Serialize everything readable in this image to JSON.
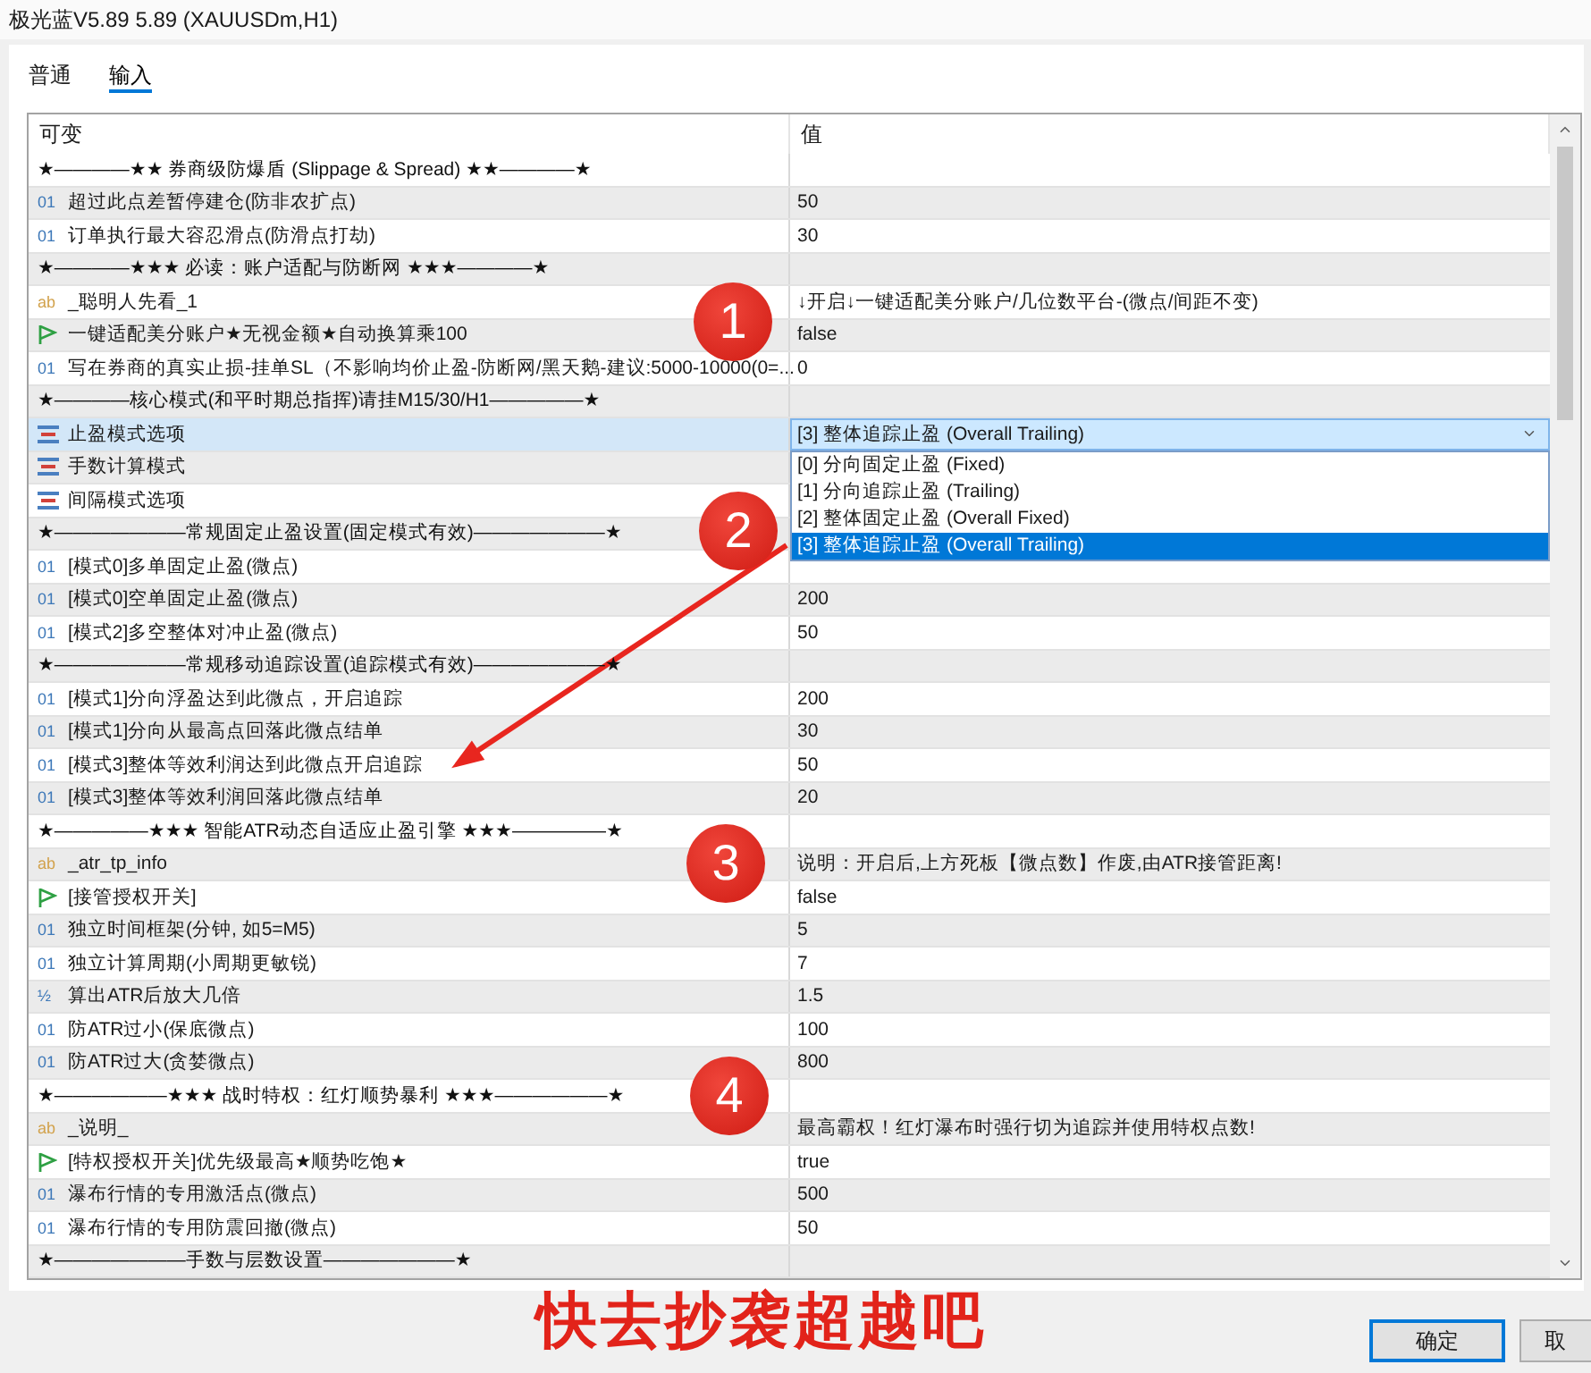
{
  "window": {
    "title": "极光蓝V5.89 5.89 (XAUUSDm,H1)"
  },
  "tabs": [
    {
      "label": "普通",
      "selected": false
    },
    {
      "label": "输入",
      "selected": true
    }
  ],
  "table": {
    "columns": [
      "可变",
      "值"
    ],
    "rows": [
      {
        "kind": "section",
        "name": "★————★★ 券商级防爆盾 (Slippage & Spread) ★★————★",
        "selected": false
      },
      {
        "kind": "int",
        "badge": "01",
        "name": "超过此点差暂停建仓(防非农扩点)",
        "value": "50",
        "selected": false
      },
      {
        "kind": "int",
        "badge": "01",
        "name": "订单执行最大容忍滑点(防滑点打劫)",
        "value": "30",
        "selected": false
      },
      {
        "kind": "section",
        "name": "★————★★★ 必读：账户适配与防断网 ★★★————★",
        "selected": false
      },
      {
        "kind": "string",
        "badge": "ab",
        "name": "_聪明人先看_1",
        "value": "↓开启↓一键适配美分账户/几位数平台-(微点/间距不变)",
        "selected": false
      },
      {
        "kind": "bool",
        "name": "一键适配美分账户★无视金额★自动换算乘100",
        "value": "false",
        "selected": false
      },
      {
        "kind": "int",
        "badge": "01",
        "name": "写在券商的真实止损-挂单SL（不影响均价止盈-防断网/黑天鹅-建议:5000-10000(0=...",
        "value": "0",
        "selected": false
      },
      {
        "kind": "section",
        "name": "★————核心模式(和平时期总指挥)请挂M15/30/H1—————★",
        "selected": false
      },
      {
        "kind": "enum",
        "name": "止盈模式选项",
        "selected": true,
        "dropdown": {
          "value": "[3] 整体追踪止盈 (Overall Trailing)",
          "expanded": true,
          "options": [
            {
              "label": "[0] 分向固定止盈 (Fixed)",
              "selected": false
            },
            {
              "label": "[1] 分向追踪止盈 (Trailing)",
              "selected": false
            },
            {
              "label": "[2] 整体固定止盈 (Overall Fixed)",
              "selected": false
            },
            {
              "label": "[3] 整体追踪止盈 (Overall Trailing)",
              "selected": true
            }
          ]
        }
      },
      {
        "kind": "enum",
        "name": "手数计算模式",
        "selected": false
      },
      {
        "kind": "enum",
        "name": "间隔模式选项",
        "selected": false
      },
      {
        "kind": "section",
        "name": "★———————常规固定止盈设置(固定模式有效)———————★",
        "selected": false
      },
      {
        "kind": "int",
        "badge": "01",
        "name": "[模式0]多单固定止盈(微点)",
        "selected": false
      },
      {
        "kind": "int",
        "badge": "01",
        "name": "[模式0]空单固定止盈(微点)",
        "value": "200",
        "selected": false
      },
      {
        "kind": "int",
        "badge": "01",
        "name": "[模式2]多空整体对冲止盈(微点)",
        "value": "50",
        "selected": false
      },
      {
        "kind": "section",
        "name": "★———————常规移动追踪设置(追踪模式有效)———————★",
        "selected": false
      },
      {
        "kind": "int",
        "badge": "01",
        "name": "[模式1]分向浮盈达到此微点，开启追踪",
        "value": "200",
        "selected": false
      },
      {
        "kind": "int",
        "badge": "01",
        "name": "[模式1]分向从最高点回落此微点结单",
        "value": "30",
        "selected": false
      },
      {
        "kind": "int",
        "badge": "01",
        "name": "[模式3]整体等效利润达到此微点开启追踪",
        "value": "50",
        "selected": false
      },
      {
        "kind": "int",
        "badge": "01",
        "name": "[模式3]整体等效利润回落此微点结单",
        "value": "20",
        "selected": false
      },
      {
        "kind": "section",
        "name": "★—————★★★ 智能ATR动态自适应止盈引擎 ★★★—————★",
        "selected": false
      },
      {
        "kind": "string",
        "badge": "ab",
        "name": "_atr_tp_info",
        "value": "说明：开启后,上方死板【微点数】作废,由ATR接管距离!",
        "selected": false
      },
      {
        "kind": "bool",
        "name": "[接管授权开关]",
        "value": "false",
        "selected": false
      },
      {
        "kind": "int",
        "badge": "01",
        "name": "独立时间框架(分钟, 如5=M5)",
        "value": "5",
        "selected": false
      },
      {
        "kind": "int",
        "badge": "01",
        "name": "独立计算周期(小周期更敏锐)",
        "value": "7",
        "selected": false
      },
      {
        "kind": "double",
        "badge": "½",
        "name": "算出ATR后放大几倍",
        "value": "1.5",
        "selected": false
      },
      {
        "kind": "int",
        "badge": "01",
        "name": "防ATR过小(保底微点)",
        "value": "100",
        "selected": false
      },
      {
        "kind": "int",
        "badge": "01",
        "name": "防ATR过大(贪婪微点)",
        "value": "800",
        "selected": false
      },
      {
        "kind": "section",
        "name": "★——————★★★ 战时特权：红灯顺势暴利 ★★★——————★",
        "selected": false
      },
      {
        "kind": "string",
        "badge": "ab",
        "name": "_说明_",
        "value": "最高霸权！红灯瀑布时强行切为追踪并使用特权点数!",
        "selected": false
      },
      {
        "kind": "bool",
        "name": "[特权授权开关]优先级最高★顺势吃饱★",
        "value": "true",
        "selected": false
      },
      {
        "kind": "int",
        "badge": "01",
        "name": "瀑布行情的专用激活点(微点)",
        "value": "500",
        "selected": false
      },
      {
        "kind": "int",
        "badge": "01",
        "name": "瀑布行情的专用防震回撤(微点)",
        "value": "50",
        "selected": false
      },
      {
        "kind": "section",
        "name": "★———————手数与层数设置———————★",
        "selected": false
      }
    ]
  },
  "buttons": [
    {
      "label": "确定",
      "default": true
    },
    {
      "label": "取",
      "default": false
    }
  ],
  "annotations": {
    "markers": [
      {
        "label": "1"
      },
      {
        "label": "2"
      },
      {
        "label": "3"
      },
      {
        "label": "4"
      }
    ],
    "caption": "快去抄袭超越吧"
  }
}
